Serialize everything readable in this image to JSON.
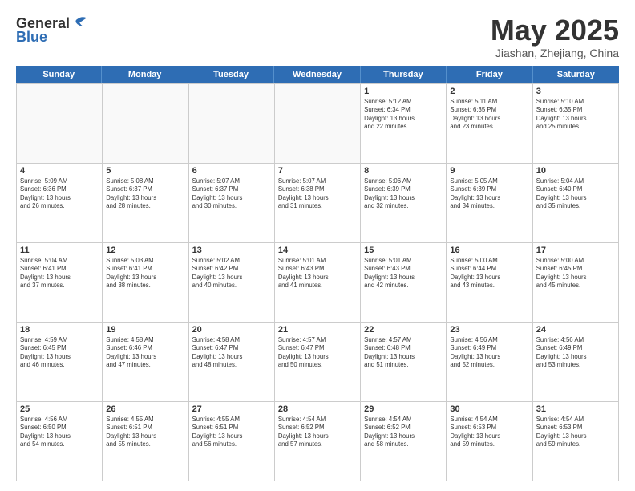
{
  "header": {
    "logo_general": "General",
    "logo_blue": "Blue",
    "month": "May 2025",
    "location": "Jiashan, Zhejiang, China"
  },
  "weekdays": [
    "Sunday",
    "Monday",
    "Tuesday",
    "Wednesday",
    "Thursday",
    "Friday",
    "Saturday"
  ],
  "weeks": [
    [
      {
        "day": "",
        "info": ""
      },
      {
        "day": "",
        "info": ""
      },
      {
        "day": "",
        "info": ""
      },
      {
        "day": "",
        "info": ""
      },
      {
        "day": "1",
        "info": "Sunrise: 5:12 AM\nSunset: 6:34 PM\nDaylight: 13 hours\nand 22 minutes."
      },
      {
        "day": "2",
        "info": "Sunrise: 5:11 AM\nSunset: 6:35 PM\nDaylight: 13 hours\nand 23 minutes."
      },
      {
        "day": "3",
        "info": "Sunrise: 5:10 AM\nSunset: 6:35 PM\nDaylight: 13 hours\nand 25 minutes."
      }
    ],
    [
      {
        "day": "4",
        "info": "Sunrise: 5:09 AM\nSunset: 6:36 PM\nDaylight: 13 hours\nand 26 minutes."
      },
      {
        "day": "5",
        "info": "Sunrise: 5:08 AM\nSunset: 6:37 PM\nDaylight: 13 hours\nand 28 minutes."
      },
      {
        "day": "6",
        "info": "Sunrise: 5:07 AM\nSunset: 6:37 PM\nDaylight: 13 hours\nand 30 minutes."
      },
      {
        "day": "7",
        "info": "Sunrise: 5:07 AM\nSunset: 6:38 PM\nDaylight: 13 hours\nand 31 minutes."
      },
      {
        "day": "8",
        "info": "Sunrise: 5:06 AM\nSunset: 6:39 PM\nDaylight: 13 hours\nand 32 minutes."
      },
      {
        "day": "9",
        "info": "Sunrise: 5:05 AM\nSunset: 6:39 PM\nDaylight: 13 hours\nand 34 minutes."
      },
      {
        "day": "10",
        "info": "Sunrise: 5:04 AM\nSunset: 6:40 PM\nDaylight: 13 hours\nand 35 minutes."
      }
    ],
    [
      {
        "day": "11",
        "info": "Sunrise: 5:04 AM\nSunset: 6:41 PM\nDaylight: 13 hours\nand 37 minutes."
      },
      {
        "day": "12",
        "info": "Sunrise: 5:03 AM\nSunset: 6:41 PM\nDaylight: 13 hours\nand 38 minutes."
      },
      {
        "day": "13",
        "info": "Sunrise: 5:02 AM\nSunset: 6:42 PM\nDaylight: 13 hours\nand 40 minutes."
      },
      {
        "day": "14",
        "info": "Sunrise: 5:01 AM\nSunset: 6:43 PM\nDaylight: 13 hours\nand 41 minutes."
      },
      {
        "day": "15",
        "info": "Sunrise: 5:01 AM\nSunset: 6:43 PM\nDaylight: 13 hours\nand 42 minutes."
      },
      {
        "day": "16",
        "info": "Sunrise: 5:00 AM\nSunset: 6:44 PM\nDaylight: 13 hours\nand 43 minutes."
      },
      {
        "day": "17",
        "info": "Sunrise: 5:00 AM\nSunset: 6:45 PM\nDaylight: 13 hours\nand 45 minutes."
      }
    ],
    [
      {
        "day": "18",
        "info": "Sunrise: 4:59 AM\nSunset: 6:45 PM\nDaylight: 13 hours\nand 46 minutes."
      },
      {
        "day": "19",
        "info": "Sunrise: 4:58 AM\nSunset: 6:46 PM\nDaylight: 13 hours\nand 47 minutes."
      },
      {
        "day": "20",
        "info": "Sunrise: 4:58 AM\nSunset: 6:47 PM\nDaylight: 13 hours\nand 48 minutes."
      },
      {
        "day": "21",
        "info": "Sunrise: 4:57 AM\nSunset: 6:47 PM\nDaylight: 13 hours\nand 50 minutes."
      },
      {
        "day": "22",
        "info": "Sunrise: 4:57 AM\nSunset: 6:48 PM\nDaylight: 13 hours\nand 51 minutes."
      },
      {
        "day": "23",
        "info": "Sunrise: 4:56 AM\nSunset: 6:49 PM\nDaylight: 13 hours\nand 52 minutes."
      },
      {
        "day": "24",
        "info": "Sunrise: 4:56 AM\nSunset: 6:49 PM\nDaylight: 13 hours\nand 53 minutes."
      }
    ],
    [
      {
        "day": "25",
        "info": "Sunrise: 4:56 AM\nSunset: 6:50 PM\nDaylight: 13 hours\nand 54 minutes."
      },
      {
        "day": "26",
        "info": "Sunrise: 4:55 AM\nSunset: 6:51 PM\nDaylight: 13 hours\nand 55 minutes."
      },
      {
        "day": "27",
        "info": "Sunrise: 4:55 AM\nSunset: 6:51 PM\nDaylight: 13 hours\nand 56 minutes."
      },
      {
        "day": "28",
        "info": "Sunrise: 4:54 AM\nSunset: 6:52 PM\nDaylight: 13 hours\nand 57 minutes."
      },
      {
        "day": "29",
        "info": "Sunrise: 4:54 AM\nSunset: 6:52 PM\nDaylight: 13 hours\nand 58 minutes."
      },
      {
        "day": "30",
        "info": "Sunrise: 4:54 AM\nSunset: 6:53 PM\nDaylight: 13 hours\nand 59 minutes."
      },
      {
        "day": "31",
        "info": "Sunrise: 4:54 AM\nSunset: 6:53 PM\nDaylight: 13 hours\nand 59 minutes."
      }
    ]
  ]
}
